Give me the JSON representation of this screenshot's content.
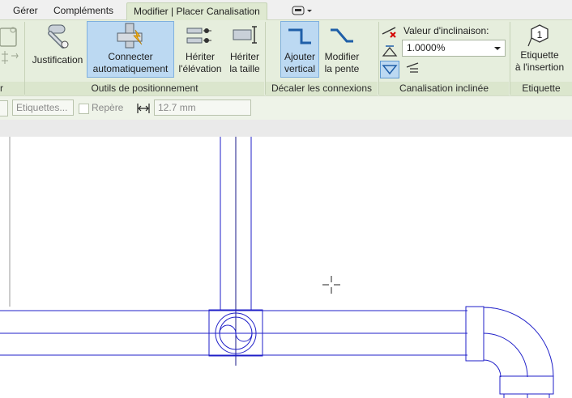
{
  "tabs": [
    {
      "label": "Gérer"
    },
    {
      "label": "Compléments"
    },
    {
      "label": "Modifier | Placer Canalisation"
    }
  ],
  "ribbon": {
    "positioning": {
      "label": "Outils de positionnement",
      "justification": "Justification",
      "auto_connect_1": "Connecter",
      "auto_connect_2": "automatiquement",
      "inherit_elev_1": "Hériter",
      "inherit_elev_2": "l'élévation",
      "inherit_size_1": "Hériter",
      "inherit_size_2": "la taille"
    },
    "offset": {
      "label": "Décaler les connexions",
      "add_vertical_1": "Ajouter",
      "add_vertical_2": "vertical",
      "modify_slope_1": "Modifier",
      "modify_slope_2": "la pente"
    },
    "slope": {
      "label": "Canalisation inclinée",
      "value_label": "Valeur d'inclinaison:",
      "value": "1.0000%"
    },
    "tag": {
      "label": "Etiquette",
      "btn_1": "Etiquette",
      "btn_2": "à l'insertion",
      "icon_number": "1"
    }
  },
  "options": {
    "tags_placeholder": "Etiquettes...",
    "repere_label": "Repère",
    "length_value": "12.7 mm"
  },
  "colors": {
    "ribbon_bg": "#e6eedd",
    "active_tab": "#dfe9d1",
    "selected_button": "#bcd9f2",
    "pipe_lines": "#1f1fc8"
  }
}
